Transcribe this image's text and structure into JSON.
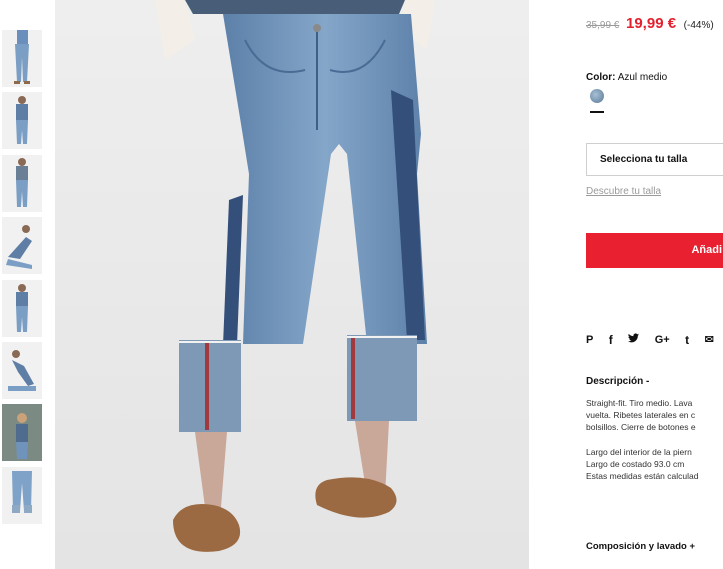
{
  "product": {
    "old_price": "35,99 €",
    "new_price": "19,99 €",
    "discount": "(-44%)",
    "color_label": "Color:",
    "color_value": "Azul medio",
    "size_select": "Selecciona tu talla",
    "size_guide": "Descubre tu talla",
    "add_button": "Añadi",
    "description_title": "Descripción -",
    "description_lines": [
      "Straight-fit. Tiro medio. Lava",
      "vuelta. Ribetes laterales en c",
      "bolsillos. Cierre de botones e"
    ],
    "measure_lines": [
      "Largo del interior de la piern",
      "Largo de costado 93.0 cm",
      "Estas medidas están calculad"
    ],
    "composition_title": "Composición y lavado +"
  },
  "share": {
    "pinterest": "P",
    "facebook": "f",
    "twitter": "♥",
    "google": "G+",
    "tumblr": "t",
    "mail": "✉"
  },
  "colors": {
    "price_red": "#e3212e",
    "button_red": "#e8202f",
    "denim": "#6c8fb6",
    "denim_dark": "#34507a",
    "shoe": "#9c6a42",
    "swatch": "#7895b0"
  },
  "icons": [
    "pinterest-icon",
    "facebook-icon",
    "twitter-icon",
    "google-plus-icon",
    "tumblr-icon",
    "mail-icon"
  ]
}
